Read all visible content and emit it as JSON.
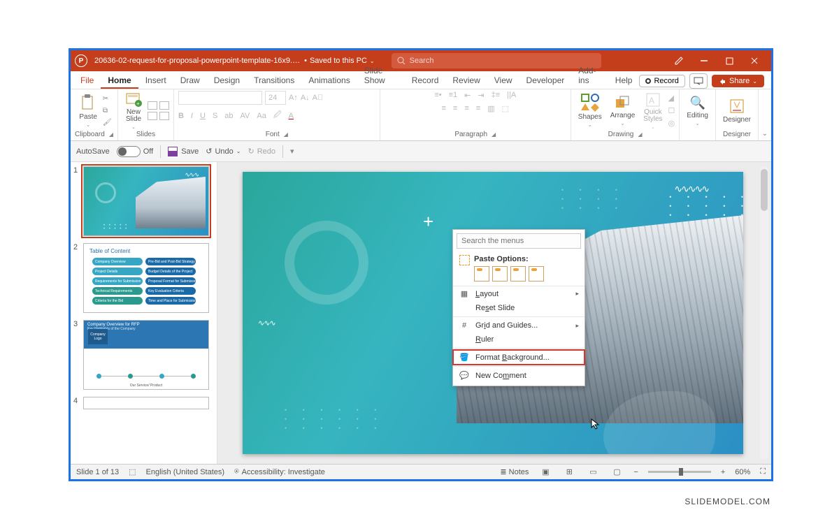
{
  "titlebar": {
    "filename": "20636-02-request-for-proposal-powerpoint-template-16x9.…",
    "saved_label": "Saved to this PC",
    "search_placeholder": "Search"
  },
  "tabs": {
    "file": "File",
    "home": "Home",
    "insert": "Insert",
    "draw": "Draw",
    "design": "Design",
    "transitions": "Transitions",
    "animations": "Animations",
    "slideshow": "Slide Show",
    "record": "Record",
    "review": "Review",
    "view": "View",
    "developer": "Developer",
    "addins": "Add-ins",
    "help": "Help",
    "record_btn": "Record",
    "share_btn": "Share"
  },
  "ribbon": {
    "paste": "Paste",
    "clipboard": "Clipboard",
    "new_slide": "New\nSlide",
    "slides": "Slides",
    "font_size": "24",
    "font": "Font",
    "paragraph": "Paragraph",
    "shapes": "Shapes",
    "arrange": "Arrange",
    "quick_styles": "Quick\nStyles",
    "drawing": "Drawing",
    "editing": "Editing",
    "designer": "Designer",
    "designer_grp": "Designer"
  },
  "qat": {
    "autosave": "AutoSave",
    "off": "Off",
    "save": "Save",
    "undo": "Undo",
    "redo": "Redo"
  },
  "thumbs": {
    "t2_title": "Table of Content",
    "t2_pills": [
      "Company Overview",
      "Pre-Bid and Post-Bid Strategy",
      "Project Details",
      "Budget Details of the Project",
      "Requirements for Submission",
      "Proposal Format for Submission",
      "Technical Requirements",
      "Key Evaluation Criteria",
      "Criteria for the Bid",
      "Time and Place for Submission"
    ],
    "t3_title": "Company Overview for RFP",
    "t3_sub": "Key Highlights of the Company",
    "t3_logo": "Company\nLogo",
    "t3_service": "Our Service/\nProduct"
  },
  "context": {
    "search_placeholder": "Search the menus",
    "paste_options": "Paste Options:",
    "layout": "Layout",
    "reset": "Reset Slide",
    "grid": "Grid and Guides...",
    "ruler": "Ruler",
    "format_bg": "Format Background...",
    "new_comment": "New Comment"
  },
  "status": {
    "slide": "Slide 1 of 13",
    "lang": "English (United States)",
    "access": "Accessibility: Investigate",
    "notes": "Notes",
    "zoom": "60%"
  },
  "watermark": "SLIDEMODEL.COM"
}
